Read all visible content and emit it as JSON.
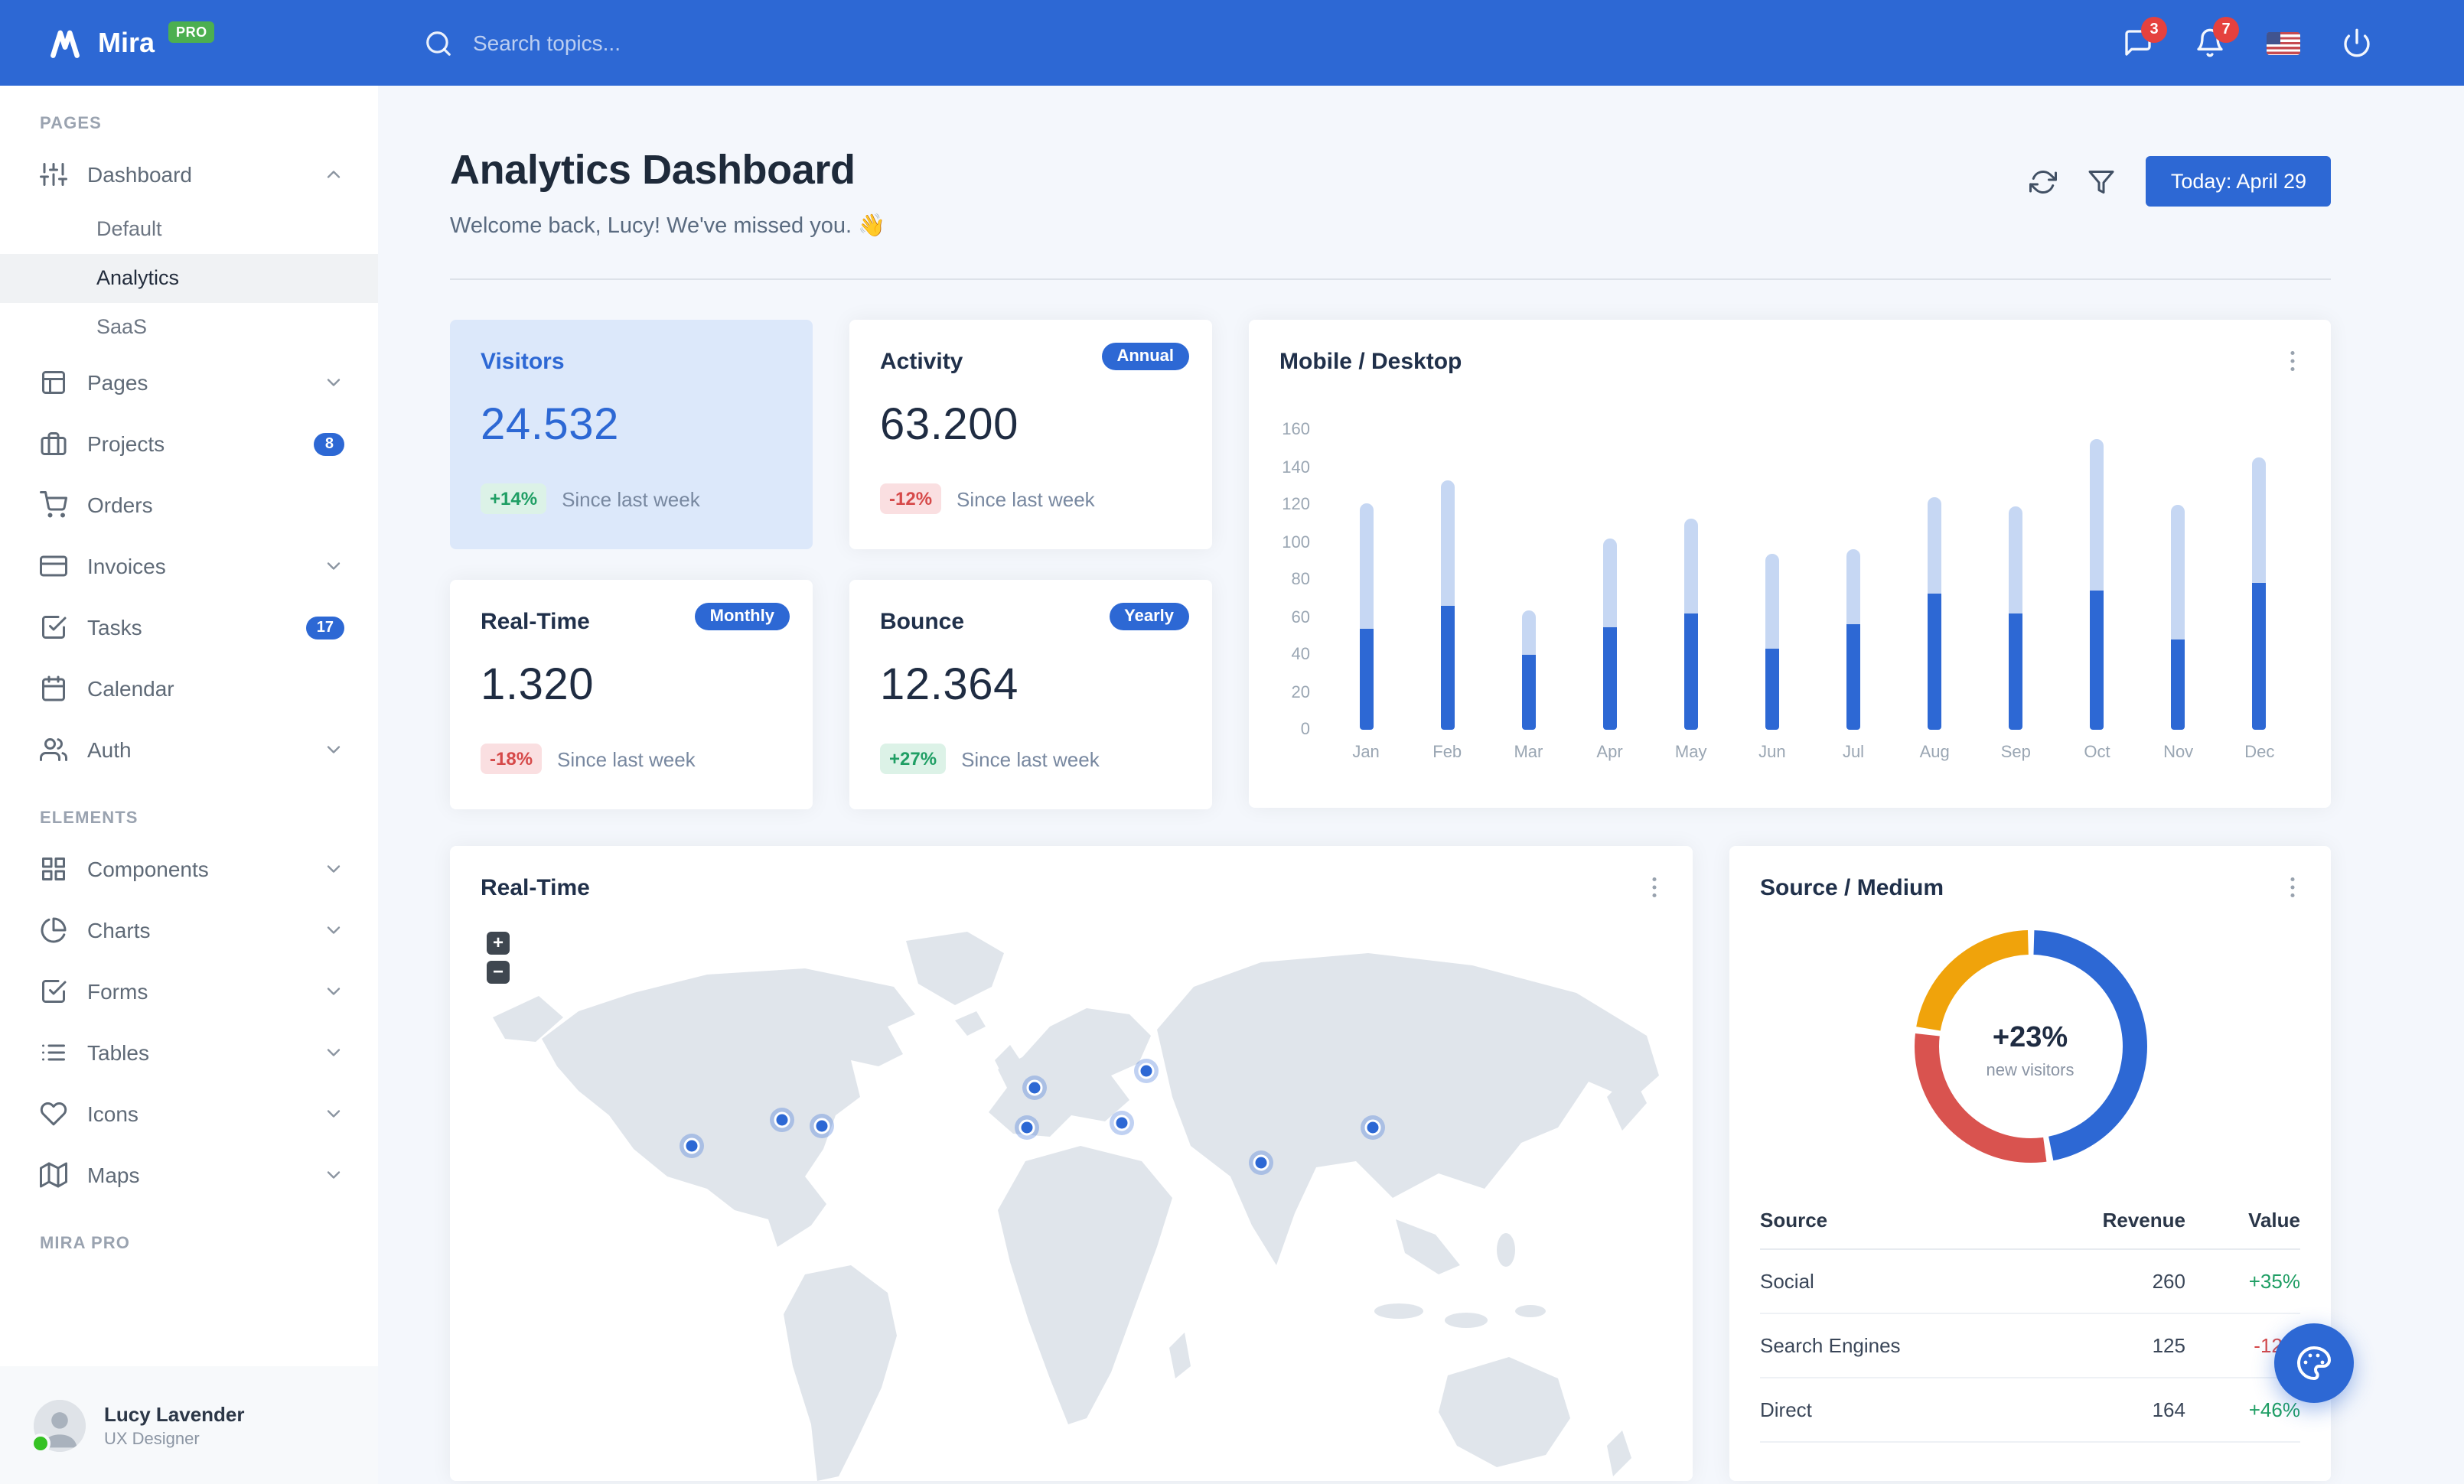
{
  "navbar": {
    "brand": "Mira",
    "brand_badge": "PRO",
    "search_placeholder": "Search topics...",
    "messages_badge": "3",
    "notifications_badge": "7"
  },
  "header": {
    "title": "Analytics Dashboard",
    "subtitle": "Welcome back, Lucy! We've missed you. 👋",
    "date_button": "Today: April 29"
  },
  "stats": [
    {
      "title": "Visitors",
      "value": "24.532",
      "delta": "+14%",
      "direction": "up",
      "caption": "Since last week",
      "highlight": true
    },
    {
      "title": "Activity",
      "badge": "Annual",
      "value": "63.200",
      "delta": "-12%",
      "direction": "down",
      "caption": "Since last week"
    },
    {
      "title": "Real-Time",
      "badge": "Monthly",
      "value": "1.320",
      "delta": "-18%",
      "direction": "down",
      "caption": "Since last week"
    },
    {
      "title": "Bounce",
      "badge": "Yearly",
      "value": "12.364",
      "delta": "+27%",
      "direction": "up",
      "caption": "Since last week"
    }
  ],
  "chart_data": [
    {
      "id": "mobile-desktop",
      "type": "bar",
      "stacked": true,
      "title": "Mobile / Desktop",
      "categories": [
        "Jan",
        "Feb",
        "Mar",
        "Apr",
        "May",
        "Jun",
        "Jul",
        "Aug",
        "Sep",
        "Oct",
        "Nov",
        "Dec"
      ],
      "series": [
        {
          "name": "Desktop",
          "color": "#2d68d4",
          "values": [
            54,
            66,
            40,
            55,
            62,
            43,
            56,
            73,
            62,
            74,
            48,
            78
          ]
        },
        {
          "name": "Mobile",
          "color": "#c6d7f3",
          "values": [
            67,
            67,
            24,
            47,
            51,
            51,
            40,
            51,
            57,
            81,
            72,
            67
          ]
        }
      ],
      "ylim": [
        0,
        160
      ],
      "yticks": [
        0,
        20,
        40,
        60,
        80,
        100,
        120,
        140,
        160
      ],
      "grid": false,
      "legend": "none"
    },
    {
      "id": "source-medium",
      "type": "donut",
      "title": "Source / Medium",
      "labels": [
        "Social",
        "Direct",
        "Search Engines"
      ],
      "values": [
        260,
        164,
        125
      ],
      "colors": [
        "#2d68d4",
        "#d9534f",
        "#f0a30b"
      ],
      "center_value": "+23%",
      "center_label": "new visitors"
    }
  ],
  "map": {
    "title": "Real-Time",
    "zoom_in": "+",
    "zoom_out": "−",
    "markers": [
      [
        158,
        148
      ],
      [
        217,
        131
      ],
      [
        243,
        135
      ],
      [
        377,
        136
      ],
      [
        382,
        110
      ],
      [
        439,
        133
      ],
      [
        455,
        99
      ],
      [
        530,
        159
      ],
      [
        603,
        136
      ]
    ]
  },
  "source_medium": {
    "table": {
      "headers": [
        "Source",
        "Revenue",
        "Value"
      ],
      "rows": [
        {
          "source": "Social",
          "revenue": "260",
          "value": "+35%",
          "direction": "up"
        },
        {
          "source": "Search Engines",
          "revenue": "125",
          "value": "-12%",
          "direction": "down"
        },
        {
          "source": "Direct",
          "revenue": "164",
          "value": "+46%",
          "direction": "up"
        }
      ]
    }
  },
  "sidebar": {
    "sections": [
      {
        "header": "PAGES",
        "items": [
          {
            "label": "Dashboard",
            "icon": "sliders",
            "chevron": "up",
            "children": [
              {
                "label": "Default"
              },
              {
                "label": "Analytics",
                "active": true
              },
              {
                "label": "SaaS"
              }
            ]
          },
          {
            "label": "Pages",
            "icon": "layout",
            "chevron": "down"
          },
          {
            "label": "Projects",
            "icon": "briefcase",
            "badge": "8"
          },
          {
            "label": "Orders",
            "icon": "shopping-cart"
          },
          {
            "label": "Invoices",
            "icon": "credit-card",
            "chevron": "down"
          },
          {
            "label": "Tasks",
            "icon": "check-square",
            "badge": "17"
          },
          {
            "label": "Calendar",
            "icon": "calendar"
          },
          {
            "label": "Auth",
            "icon": "users",
            "chevron": "down"
          }
        ]
      },
      {
        "header": "ELEMENTS",
        "items": [
          {
            "label": "Components",
            "icon": "grid",
            "chevron": "down"
          },
          {
            "label": "Charts",
            "icon": "pie-chart",
            "chevron": "down"
          },
          {
            "label": "Forms",
            "icon": "check-square",
            "chevron": "down"
          },
          {
            "label": "Tables",
            "icon": "list",
            "chevron": "down"
          },
          {
            "label": "Icons",
            "icon": "heart",
            "chevron": "down"
          },
          {
            "label": "Maps",
            "icon": "map",
            "chevron": "down"
          }
        ]
      },
      {
        "header": "MIRA PRO",
        "items": []
      }
    ],
    "user": {
      "name": "Lucy Lavender",
      "role": "UX Designer"
    }
  },
  "colors": {
    "primary": "#2d68d4",
    "success": "#1f9e64",
    "danger": "#d64949",
    "warning": "#f0a30b",
    "highlight_card": "#dce8fa",
    "pro_badge": "#4caf50",
    "notification_badge": "#e5413e"
  }
}
